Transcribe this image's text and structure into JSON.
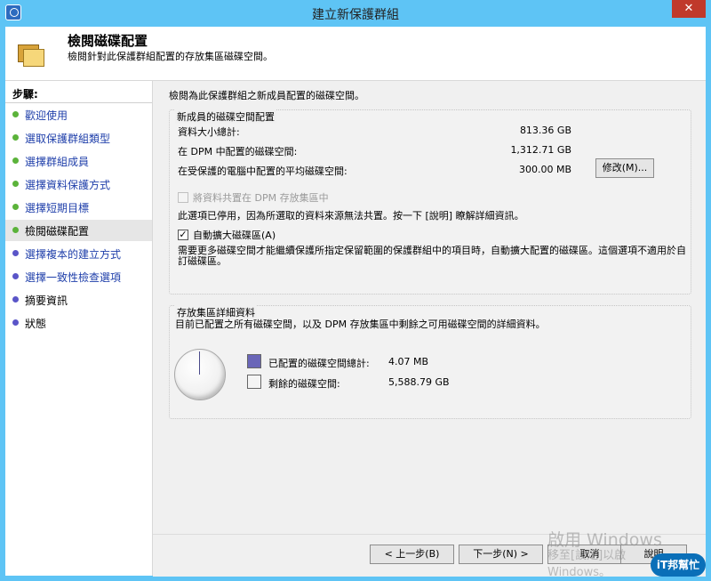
{
  "window": {
    "title": "建立新保護群組",
    "close": "✕"
  },
  "header": {
    "title": "檢閱磁碟配置",
    "subtitle": "檢閱針對此保護群組配置的存放集區磁碟空間。"
  },
  "sidebar": {
    "title": "步驟:",
    "items": [
      {
        "label": "歡迎使用"
      },
      {
        "label": "選取保護群組類型"
      },
      {
        "label": "選擇群組成員"
      },
      {
        "label": "選擇資料保護方式"
      },
      {
        "label": "選擇短期目標"
      },
      {
        "label": "檢閱磁碟配置"
      },
      {
        "label": "選擇複本的建立方式"
      },
      {
        "label": "選擇一致性檢查選項"
      },
      {
        "label": "摘要資訊"
      },
      {
        "label": "狀態"
      }
    ]
  },
  "main": {
    "intro": "檢閱為此保護群組之新成員配置的磁碟空間。",
    "allocation": {
      "title": "新成員的磁碟空間配置",
      "rows": [
        {
          "label": "資料大小總計:",
          "value": "813.36 GB"
        },
        {
          "label": "在 DPM 中配置的磁碟空間:",
          "value": "1,312.71 GB"
        },
        {
          "label": "在受保護的電腦中配置的平均磁碟空間:",
          "value": "300.00 MB"
        }
      ],
      "modify_button": "修改(M)...",
      "colocate_label": "將資料共置在 DPM 存放集區中",
      "colocate_note": "此選項已停用，因為所選取的資料來源無法共置。按一下 [說明] 瞭解詳細資訊。",
      "autogrow_label": "自動擴大磁碟區(A)",
      "autogrow_check": "✓",
      "autogrow_note": "需要更多磁碟空間才能繼續保護所指定保留範圍的保護群組中的項目時，自動擴大配置的磁碟區。這個選項不適用於自訂磁碟區。"
    },
    "storage": {
      "title": "存放集區詳細資料",
      "description": "目前已配置之所有磁碟空間，以及 DPM 存放集區中剩餘之可用磁碟空間的詳細資料。",
      "allocated_label": "已配置的磁碟空間總計:",
      "allocated_value": "4.07 MB",
      "remaining_label": "剩餘的磁碟空間:",
      "remaining_value": "5,588.79 GB",
      "allocated_color": "#6a66b8",
      "remaining_color": "#f4f4f4"
    }
  },
  "buttons": {
    "back": "< 上一步(B)",
    "next": "下一步(N) >",
    "cancel": "取消",
    "help": "說明"
  },
  "watermark": {
    "line1": "啟用 Windows",
    "line2": "移至[設定]以啟",
    "line3": "Windows。"
  },
  "badge": {
    "text": "iT邦幫忙"
  }
}
